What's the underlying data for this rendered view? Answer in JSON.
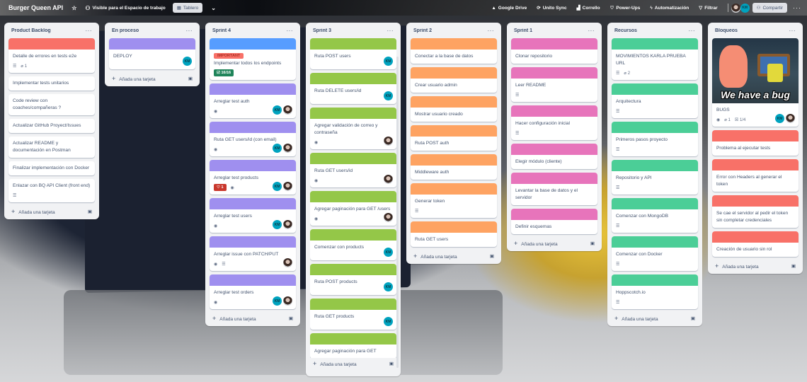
{
  "header": {
    "board_title": "Burger Queen API",
    "visibility": "Visible para el Espacio de trabajo",
    "view": "Tablero",
    "powerups": [
      {
        "icon": "google-drive-icon",
        "label": "Google Drive"
      },
      {
        "icon": "unito-sync-icon",
        "label": "Unito Sync"
      },
      {
        "icon": "corrello-icon",
        "label": "Corrello"
      },
      {
        "icon": "power-ups-icon",
        "label": "Power-Ups"
      },
      {
        "icon": "automation-icon",
        "label": "Automatización"
      },
      {
        "icon": "filter-icon",
        "label": "Filtrar"
      }
    ],
    "member_initials": "KM",
    "share_label": "Compartir"
  },
  "add_card_label": "Añada una tarjeta",
  "colors": {
    "red": "#f87168",
    "purple": "#9f8fef",
    "blue": "#579dff",
    "green": "#94c748",
    "orange": "#fea362",
    "pink": "#e774bb",
    "teal": "#4bce97"
  },
  "lists": [
    {
      "title": "Product Backlog",
      "cards": [
        {
          "title": "Detalle de errores en tests e2e",
          "cover": "red",
          "description": true,
          "attachments": "1"
        },
        {
          "title": "Implementar tests unitarios"
        },
        {
          "title": "Code review con coaches/compañeras ?"
        },
        {
          "title": "Actualizar GitHub Proyect/Issues"
        },
        {
          "title": "Actualizar README y documentación en Postman"
        },
        {
          "title": "Finalizar implementación con Docker"
        },
        {
          "title": "Enlazar con BQ API Client (front end)",
          "description": true
        }
      ]
    },
    {
      "title": "En proceso",
      "cards": [
        {
          "title": "DEPLOY",
          "cover": "purple",
          "members": [
            "KM"
          ]
        }
      ]
    },
    {
      "title": "Sprint 4",
      "cards": [
        {
          "title": "Implementar todos los endpoints",
          "cover": "blue",
          "label": "IMPORTANT",
          "checklist": "16/16"
        },
        {
          "title": "Arreglar test auth",
          "cover": "purple",
          "watch": true,
          "members": [
            "KM",
            "photo"
          ]
        },
        {
          "title": "Ruta GET users/id (con email)",
          "cover": "purple",
          "watch": true,
          "members": [
            "KM",
            "photo"
          ]
        },
        {
          "title": "Arreglar test products",
          "cover": "purple",
          "votes": "1",
          "watch": true,
          "members": [
            "KM",
            "photo"
          ]
        },
        {
          "title": "Arreglar test users",
          "cover": "purple",
          "watch": true,
          "members": [
            "KM",
            "photo"
          ]
        },
        {
          "title": "Arreglar issue con PATCH/PUT",
          "cover": "purple",
          "watch": true,
          "description": true,
          "members": [
            "photo"
          ]
        },
        {
          "title": "Arreglar test orders",
          "cover": "purple",
          "watch": true,
          "members": [
            "KM",
            "photo"
          ]
        }
      ]
    },
    {
      "title": "Sprint 3",
      "cards": [
        {
          "title": "Ruta POST users",
          "cover": "green",
          "members": [
            "KM"
          ]
        },
        {
          "title": "Ruta DELETE users/id",
          "cover": "green",
          "members": [
            "KM"
          ]
        },
        {
          "title": "Agregar validación de correo y contraseña",
          "cover": "green",
          "watch": true,
          "members": [
            "photo"
          ]
        },
        {
          "title": "Ruta GET users/id",
          "cover": "green",
          "watch": true,
          "members": [
            "photo"
          ]
        },
        {
          "title": "Agregar paginación para GET /users",
          "cover": "green",
          "watch": true,
          "members": [
            "photo"
          ]
        },
        {
          "title": "Comenzar con products",
          "cover": "green",
          "members": [
            "KM"
          ]
        },
        {
          "title": "Ruta POST products",
          "cover": "green",
          "members": [
            "KM"
          ]
        },
        {
          "title": "Ruta GET products",
          "cover": "green",
          "members": [
            "KM"
          ]
        },
        {
          "title": "Agregar paginación para GET",
          "cover": "green"
        }
      ]
    },
    {
      "title": "Sprint 2",
      "cards": [
        {
          "title": "Conectar a la base de datos",
          "cover": "orange"
        },
        {
          "title": "Crear usuario admin",
          "cover": "orange"
        },
        {
          "title": "Mostrar usuario creado",
          "cover": "orange"
        },
        {
          "title": "Ruta POST auth",
          "cover": "orange"
        },
        {
          "title": "Middleware auth",
          "cover": "orange"
        },
        {
          "title": "Generar token",
          "cover": "orange",
          "description": true
        },
        {
          "title": "Ruta GET users",
          "cover": "orange"
        }
      ]
    },
    {
      "title": "Sprint 1",
      "cards": [
        {
          "title": "Clonar repositorio",
          "cover": "pink"
        },
        {
          "title": "Leer README",
          "cover": "pink",
          "description": true
        },
        {
          "title": "Hacer configuración inicial",
          "cover": "pink",
          "description": true
        },
        {
          "title": "Elegir módulo (cliente)",
          "cover": "pink"
        },
        {
          "title": "Levantar la base de datos y el servidor",
          "cover": "pink"
        },
        {
          "title": "Definir esquemas",
          "cover": "pink"
        }
      ]
    },
    {
      "title": "Recursos",
      "cards": [
        {
          "title": "MOVIMIENTOS KARLA PRUEBA URL",
          "cover": "teal",
          "description": true,
          "attachments": "2"
        },
        {
          "title": "Arquitectura",
          "cover": "teal",
          "description": true
        },
        {
          "title": "Primeros pasos proyecto",
          "cover": "teal",
          "description": true
        },
        {
          "title": "Repositorio y API",
          "cover": "teal",
          "description": true
        },
        {
          "title": "Comenzar con MongoDB",
          "cover": "teal",
          "description": true
        },
        {
          "title": "Comenzar con Docker",
          "cover": "teal",
          "description": true
        },
        {
          "title": "Hoppscotch.io",
          "cover": "teal",
          "description": true
        }
      ]
    },
    {
      "title": "Bloqueos",
      "cards": [
        {
          "title": "BUGS",
          "image_caption": "We have a bug",
          "watch": true,
          "attachments": "1",
          "checklist_plain": "1/4",
          "members": [
            "KM",
            "photo"
          ]
        },
        {
          "title": "Problema al ejecutar tests",
          "cover": "red"
        },
        {
          "title": "Error con Headers al generar el token",
          "cover": "red"
        },
        {
          "title": "Se cae el servidor al pedir el token sin completar credenciales",
          "cover": "red"
        },
        {
          "title": "Creación de usuario sin rol",
          "cover": "red"
        }
      ]
    }
  ]
}
